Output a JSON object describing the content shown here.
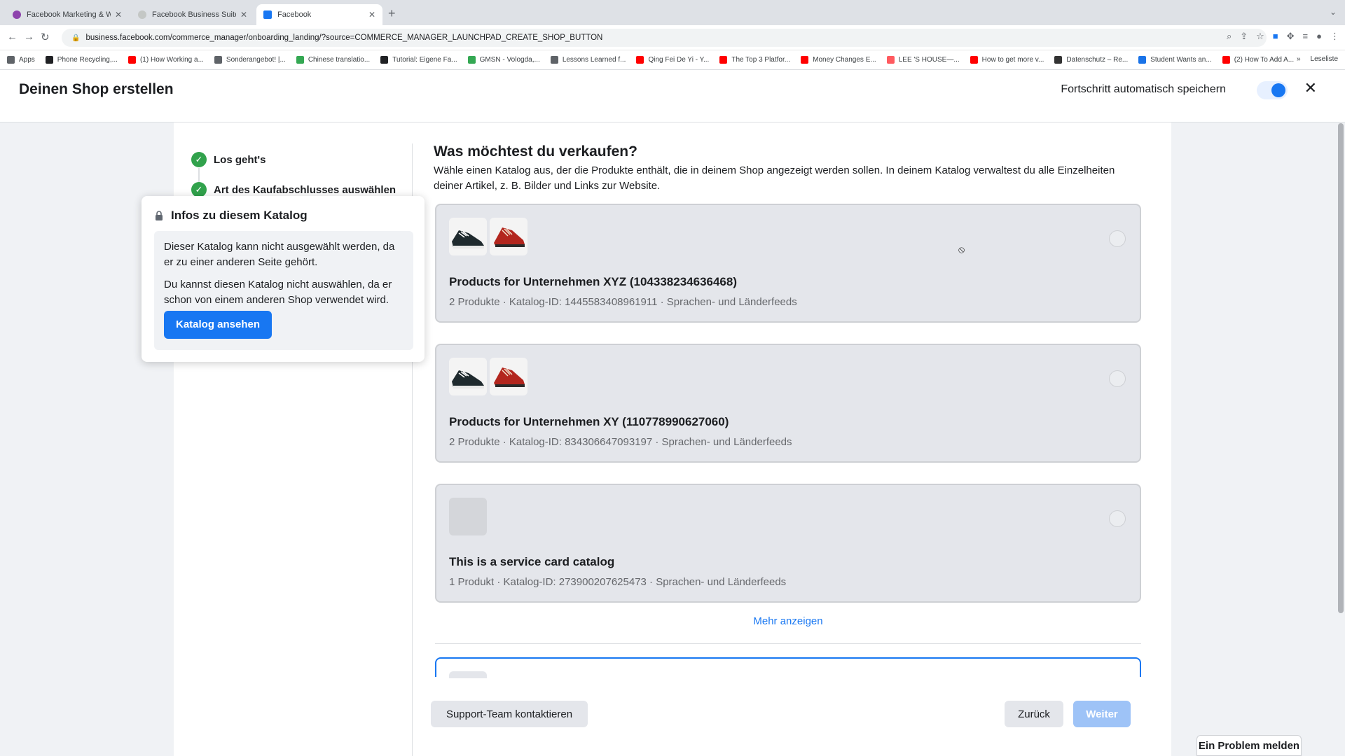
{
  "browser": {
    "tabs": [
      {
        "title": "Facebook Marketing & Werbe",
        "active": false,
        "favicon_color": "#8e44ad"
      },
      {
        "title": "Facebook Business Suite",
        "active": false,
        "favicon_color": "#5f6368"
      },
      {
        "title": "Facebook",
        "active": true,
        "favicon_color": "#1877f2"
      }
    ],
    "url": "business.facebook.com/commerce_manager/onboarding_landing/?source=COMMERCE_MANAGER_LAUNCHPAD_CREATE_SHOP_BUTTON",
    "bookmarks": [
      {
        "label": "Apps",
        "color": "#5f6368"
      },
      {
        "label": "Phone Recycling,...",
        "color": "#202124"
      },
      {
        "label": "(1) How Working a...",
        "color": "#ff0000"
      },
      {
        "label": "Sonderangebot! |...",
        "color": "#5f6368"
      },
      {
        "label": "Chinese translatio...",
        "color": "#34a853"
      },
      {
        "label": "Tutorial: Eigene Fa...",
        "color": "#202124"
      },
      {
        "label": "GMSN - Vologda,...",
        "color": "#34a853"
      },
      {
        "label": "Lessons Learned f...",
        "color": "#5f6368"
      },
      {
        "label": "Qing Fei De Yi - Y...",
        "color": "#ff0000"
      },
      {
        "label": "The Top 3 Platfor...",
        "color": "#ff0000"
      },
      {
        "label": "Money Changes E...",
        "color": "#ff0000"
      },
      {
        "label": "LEE 'S HOUSE—...",
        "color": "#ff5a5f"
      },
      {
        "label": "How to get more v...",
        "color": "#ff0000"
      },
      {
        "label": "Datenschutz – Re...",
        "color": "#333333"
      },
      {
        "label": "Student Wants an...",
        "color": "#1a73e8"
      },
      {
        "label": "(2) How To Add A...",
        "color": "#ff0000"
      }
    ],
    "bookmarks_more": "»",
    "reading_list": "Leseliste"
  },
  "header": {
    "title": "Deinen Shop erstellen",
    "autosave_label": "Fortschritt automatisch speichern",
    "autosave_on": true
  },
  "steps": [
    {
      "label": "Los geht's",
      "done": true
    },
    {
      "label": "Art des Kaufabschlusses auswählen",
      "done": true
    }
  ],
  "main": {
    "heading": "Was möchtest du verkaufen?",
    "description": "Wähle einen Katalog aus, der die Produkte enthält, die in deinem Shop angezeigt werden sollen. In deinem Katalog verwaltest du alle Einzelheiten deiner Artikel, z. B. Bilder und Links zur Website.",
    "catalogs": [
      {
        "title": "Products for Unternehmen XYZ (104338234636468)",
        "meta": "2 Produkte · Katalog-ID: 1445583408961911 · Sprachen- und Länderfeeds",
        "has_images": true
      },
      {
        "title": "Products for Unternehmen XY (110778990627060)",
        "meta": "2 Produkte · Katalog-ID: 834306647093197 · Sprachen- und Länderfeeds",
        "has_images": true
      },
      {
        "title": "This is a service card catalog",
        "meta": "1 Produkt · Katalog-ID: 273900207625473 · Sprachen- und Länderfeeds",
        "has_images": false
      }
    ],
    "show_more": "Mehr anzeigen"
  },
  "popover": {
    "title": "Infos zu diesem Katalog",
    "text1": "Dieser Katalog kann nicht ausgewählt werden, da er zu einer anderen Seite gehört.",
    "text2": "Du kannst diesen Katalog nicht auswählen, da er schon von einem anderen Shop verwendet wird.",
    "button": "Katalog ansehen"
  },
  "footer": {
    "support": "Support-Team kontaktieren",
    "back": "Zurück",
    "next": "Weiter"
  },
  "report_problem": "Ein Problem melden",
  "colors": {
    "brand_blue": "#1877f2",
    "success_green": "#31a24c",
    "disabled_blue": "#9ec3f7"
  }
}
